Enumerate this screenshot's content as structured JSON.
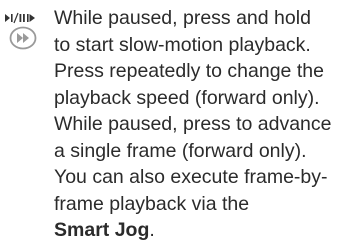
{
  "icons": {
    "play_pause": "play-pause-icon",
    "fast_forward": "circle-fast-forward-icon"
  },
  "body": {
    "lines": [
      "While paused, press and hold",
      "to start slow-motion playback.",
      "Press repeatedly to change the",
      "playback speed (forward only).",
      "While paused, press to advance",
      "a single frame (forward only).",
      "You can also execute frame-by-",
      "frame playback via the"
    ],
    "bold_term": "Smart Jog",
    "trailing": "."
  },
  "colors": {
    "text": "#2b2b2b",
    "icon_gray": "#9a9a9a",
    "icon_dark": "#333333"
  }
}
